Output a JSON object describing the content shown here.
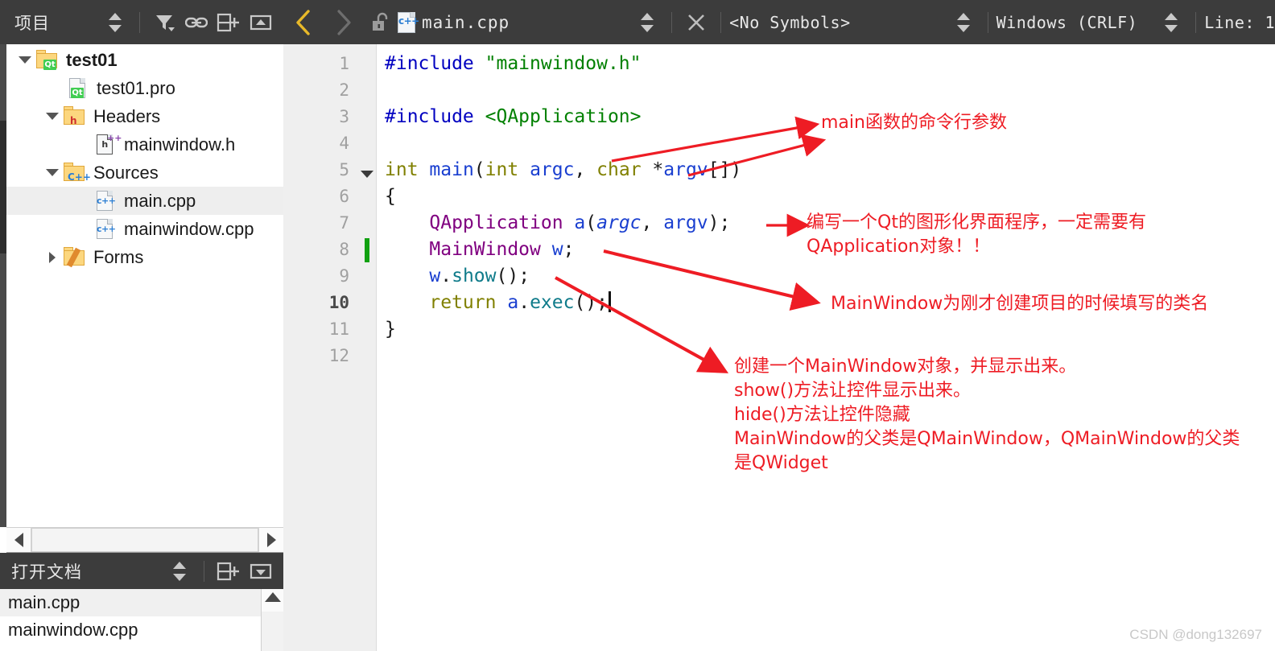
{
  "toolbar": {
    "project_label": "项目",
    "filter_icon": "filter-icon",
    "link_icon": "link-icon",
    "split_icon": "split-add-icon",
    "collapse_icon": "collapse-icon",
    "back_icon": "back-chevron-icon",
    "forward_icon": "forward-chevron-icon",
    "lock_icon": "unlock-icon",
    "file_icon_label": "c++",
    "filename": "main.cpp",
    "close_icon": "close-icon",
    "symbols": "<No Symbols>",
    "line_ending": "Windows (CRLF)",
    "line_status": "Line: 1"
  },
  "tree": {
    "items": [
      {
        "label": "test01",
        "icon": "qt-folder-icon",
        "badge": "Qt",
        "indent": 0,
        "expander": "down",
        "bold": true,
        "selected": false
      },
      {
        "label": "test01.pro",
        "icon": "qt-file-icon",
        "badge": "Qt",
        "indent": 1,
        "expander": "none",
        "bold": false,
        "selected": false
      },
      {
        "label": "Headers",
        "icon": "h-folder-icon",
        "badge": "h",
        "indent": 1,
        "expander": "down",
        "bold": false,
        "selected": false
      },
      {
        "label": "mainwindow.h",
        "icon": "h-file-icon",
        "badge": "h",
        "indent": 2,
        "expander": "none",
        "bold": false,
        "selected": false
      },
      {
        "label": "Sources",
        "icon": "cpp-folder-icon",
        "badge": "C++",
        "indent": 1,
        "expander": "down",
        "bold": false,
        "selected": false
      },
      {
        "label": "main.cpp",
        "icon": "cpp-file-icon",
        "badge": "c++",
        "indent": 2,
        "expander": "none",
        "bold": false,
        "selected": true
      },
      {
        "label": "mainwindow.cpp",
        "icon": "cpp-file-icon",
        "badge": "c++",
        "indent": 2,
        "expander": "none",
        "bold": false,
        "selected": false
      },
      {
        "label": "Forms",
        "icon": "forms-folder-icon",
        "badge": "",
        "indent": 1,
        "expander": "right",
        "bold": false,
        "selected": false
      }
    ]
  },
  "open_documents": {
    "title": "打开文档",
    "split_icon": "split-add-icon",
    "dropdown_icon": "dropdown-icon",
    "items": [
      {
        "label": "main.cpp",
        "selected": true
      },
      {
        "label": "mainwindow.cpp",
        "selected": false
      }
    ]
  },
  "editor": {
    "current_line": 10,
    "change_marker_line": 8,
    "fold_marker_line": 5,
    "line_numbers": [
      "1",
      "2",
      "3",
      "4",
      "5",
      "6",
      "7",
      "8",
      "9",
      "10",
      "11",
      "12"
    ],
    "code": [
      "#include \"mainwindow.h\"",
      "",
      "#include <QApplication>",
      "",
      "int main(int argc, char *argv[])",
      "{",
      "    QApplication a(argc, argv);",
      "    MainWindow w;",
      "    w.show();",
      "    return a.exec();",
      "}",
      ""
    ]
  },
  "annotations": [
    {
      "id": "annotation-argv",
      "text": "main函数的命令行参数"
    },
    {
      "id": "annotation-qapplication",
      "text": "编写一个Qt的图形化界面程序，一定需要有\nQApplication对象！！"
    },
    {
      "id": "annotation-mainwindow",
      "text": "MainWindow为刚才创建项目的时候填写的类名"
    },
    {
      "id": "annotation-show",
      "text": "创建一个MainWindow对象，并显示出来。\nshow()方法让控件显示出来。\nhide()方法让控件隐藏\nMainWindow的父类是QMainWindow，QMainWindow的父类\n是QWidget"
    }
  ],
  "watermark": "CSDN @dong132697",
  "colors": {
    "toolbar_bg": "#3c3c3c",
    "annotation_red": "#ee1c24",
    "accent_yellow": "#e8b929",
    "gutter_bg": "#efefef",
    "selection_bg": "#eeeeee",
    "change_marker_green": "#11a111"
  }
}
